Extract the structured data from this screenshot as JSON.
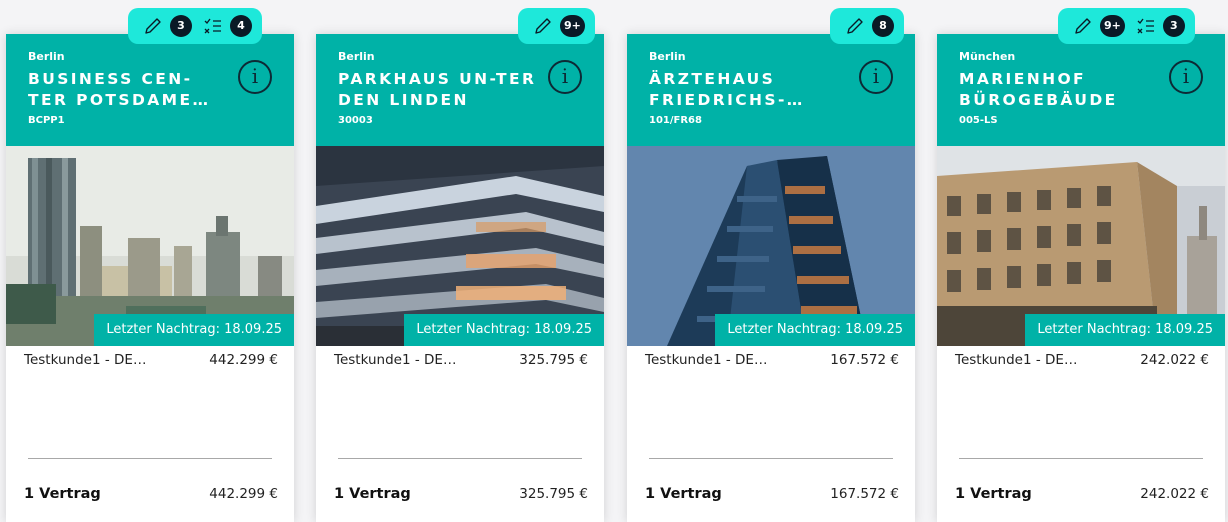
{
  "stamp_prefix": "Letzter Nachtrag:",
  "colors": {
    "accent": "#00b2a7",
    "pill": "#1ee8da",
    "badge": "#0a1a26"
  },
  "cards": [
    {
      "city": "Berlin",
      "title": "BUSINESS CEN-TER POTSDAME…",
      "code": "BCPP1",
      "last_amendment": "18.09.25",
      "customer": "Testkunde1 - DE…",
      "amount": "442.299 €",
      "contracts": "1 Vertrag",
      "total": "442.299 €",
      "edit_count": "3",
      "task_count": "4",
      "info_icon": "info-icon",
      "photo": "skyline-photo"
    },
    {
      "city": "Berlin",
      "title": "PARKHAUS UN-TER DEN LINDEN",
      "code": "30003",
      "last_amendment": "18.09.25",
      "customer": "Testkunde1 - DE…",
      "amount": "325.795 €",
      "contracts": "1 Vertrag",
      "total": "325.795 €",
      "edit_count": "9+",
      "task_count": "",
      "info_icon": "info-icon",
      "photo": "parking-garage-photo"
    },
    {
      "city": "Berlin",
      "title": "ÄRZTEHAUS FRIEDRICHS-…",
      "code": "101/FR68",
      "last_amendment": "18.09.25",
      "customer": "Testkunde1 - DE…",
      "amount": "167.572 €",
      "contracts": "1 Vertrag",
      "total": "167.572 €",
      "edit_count": "8",
      "task_count": "",
      "info_icon": "info-icon",
      "photo": "tower-facade-photo"
    },
    {
      "city": "München",
      "title": "MARIENHOF BÜROGEBÄUDE",
      "code": "005-LS",
      "last_amendment": "18.09.25",
      "customer": "Testkunde1 - DE…",
      "amount": "242.022 €",
      "contracts": "1 Vertrag",
      "total": "242.022 €",
      "edit_count": "9+",
      "task_count": "3",
      "info_icon": "info-icon",
      "photo": "historic-building-photo"
    }
  ]
}
